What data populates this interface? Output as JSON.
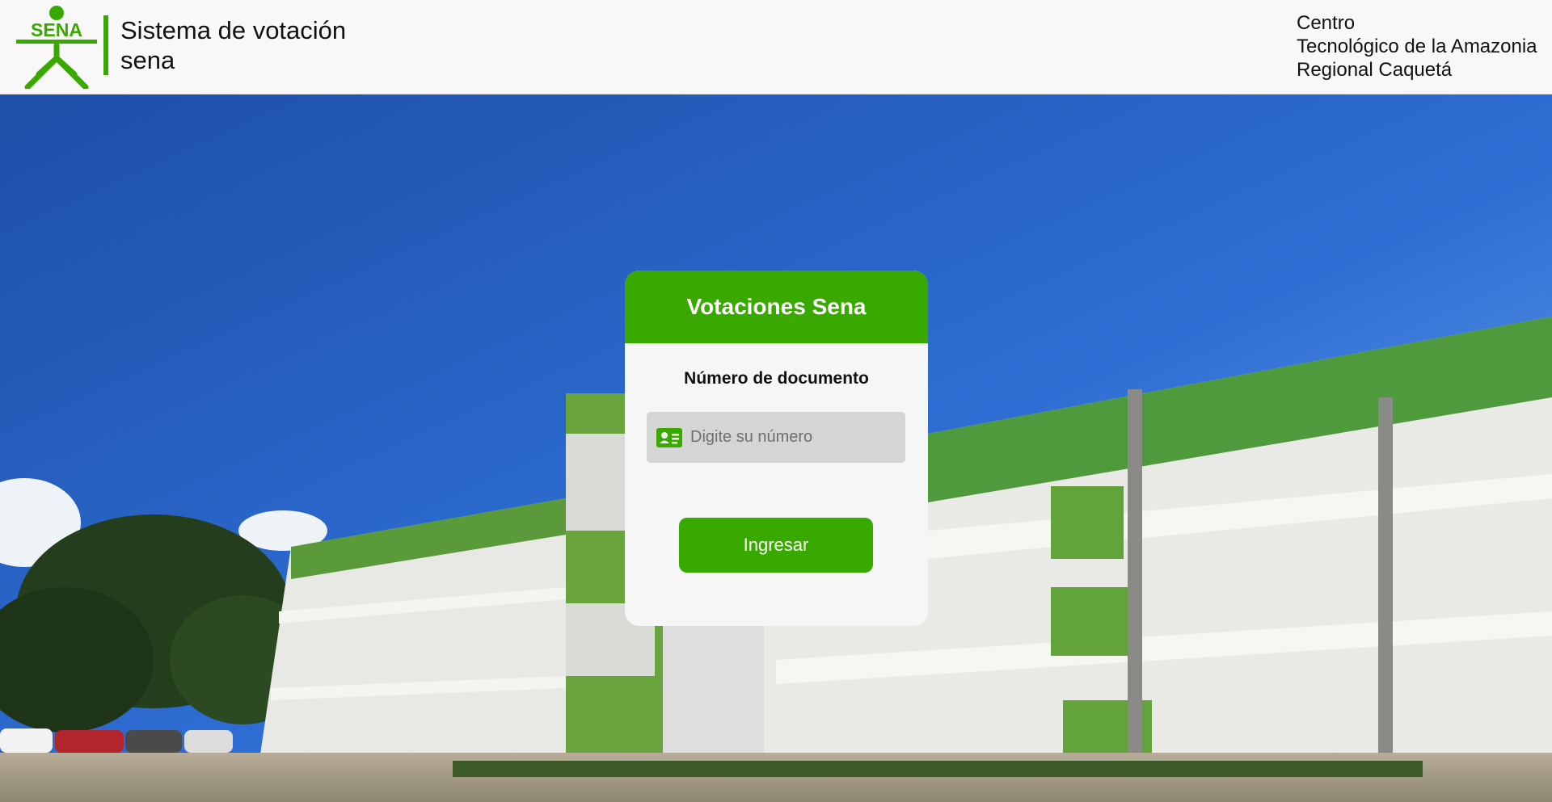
{
  "header": {
    "logo_text": "SENA",
    "title_line1": "Sistema de votación",
    "title_line2": "sena",
    "center_line1": "Centro",
    "center_line2": "Tecnológico de la Amazonia",
    "center_line3": "Regional Caquetá"
  },
  "login": {
    "title": "Votaciones Sena",
    "document_label": "Número de documento",
    "document_placeholder": "Digite su número",
    "document_value": "",
    "document_icon": "id-card-icon",
    "submit_label": "Ingresar"
  },
  "background": {
    "description_icon": "campus-building-photo"
  },
  "colors": {
    "brand_green": "#39a900",
    "header_bg": "#f8f8f8",
    "card_bg": "#f6f6f6",
    "input_bg": "#d4d6d3"
  }
}
